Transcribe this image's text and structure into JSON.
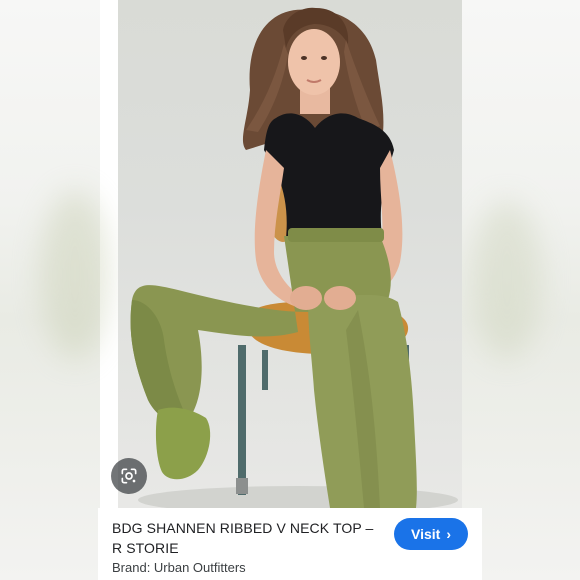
{
  "result": {
    "title": "BDG SHANNEN RIBBED V NECK TOP – R STORIE",
    "brand_line": "Brand: Urban Outfitters",
    "visit_label": "Visit",
    "visit_icon": "chevron-right-icon",
    "lens_icon": "google-lens-icon"
  },
  "image": {
    "alt": "model-photo"
  },
  "colors": {
    "accent": "#1a73e8",
    "title_text": "#202124",
    "brand_text": "#3c4043"
  }
}
